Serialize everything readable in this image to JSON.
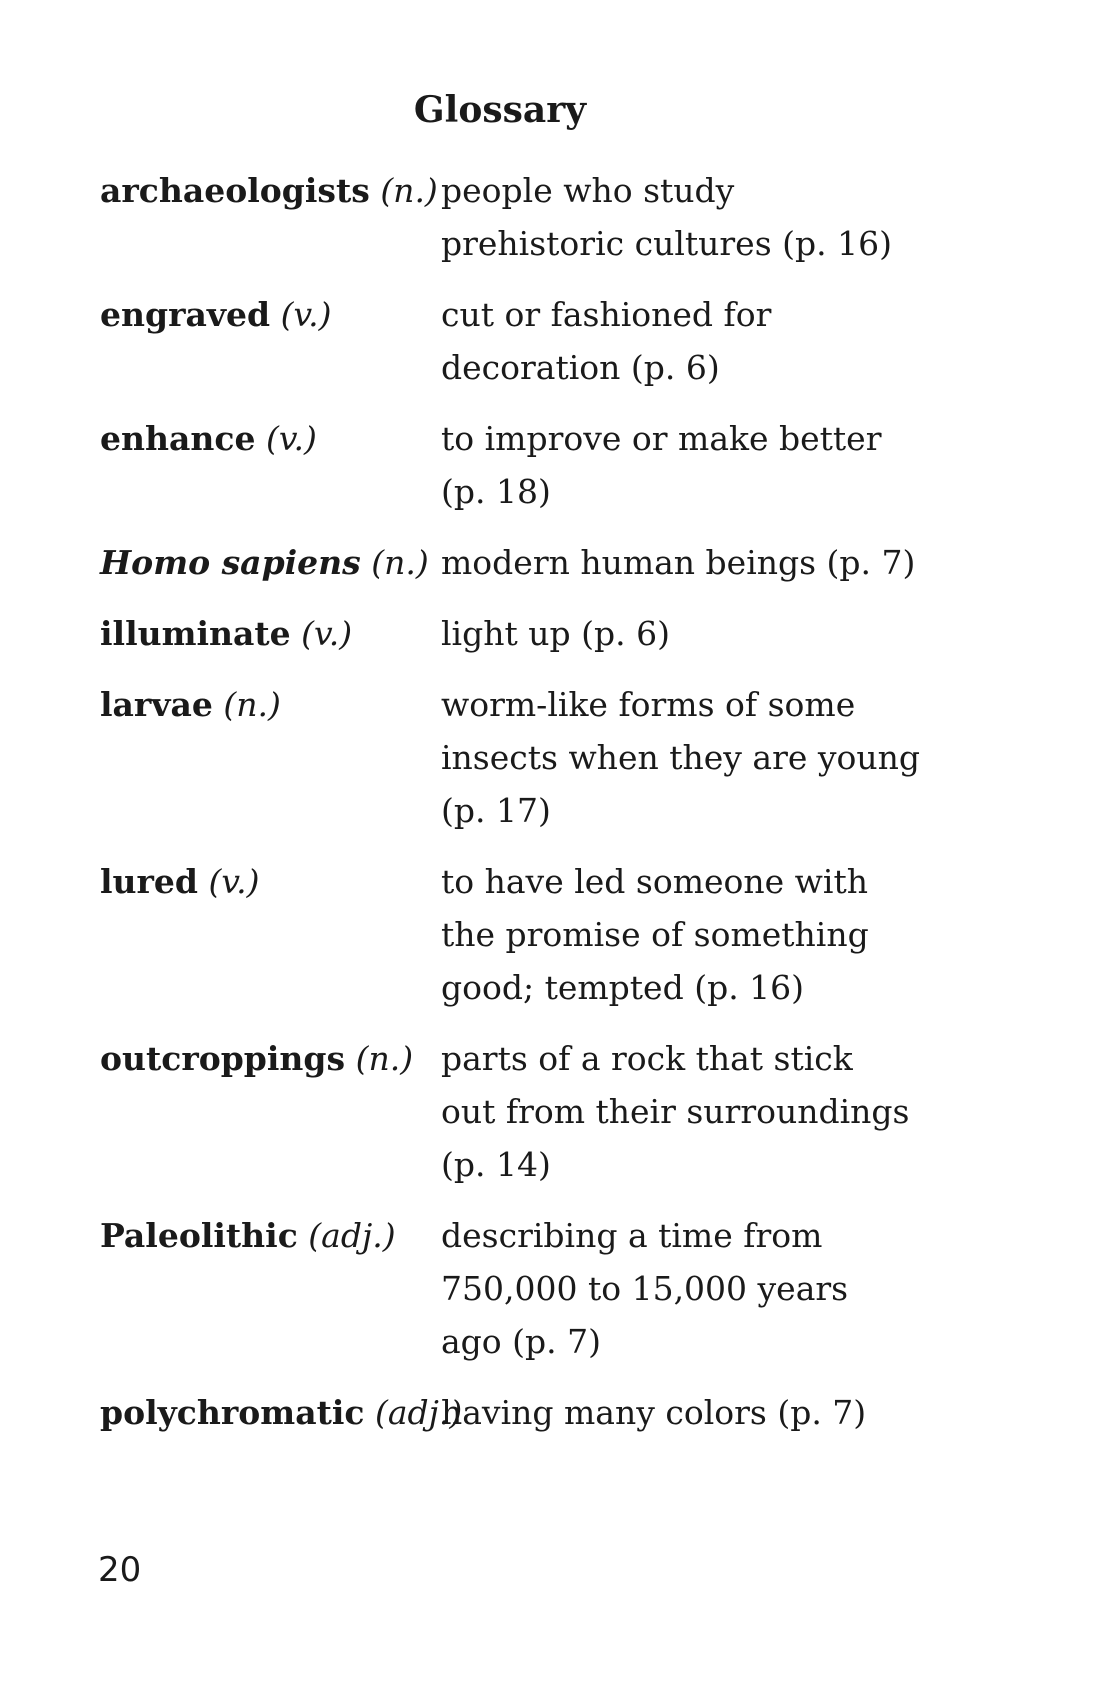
{
  "title": "Glossary",
  "entries": [
    {
      "term": "archaeologists",
      "pos": "(n.)",
      "definition": "people who study\nprehistoric cultures (p. 16)"
    },
    {
      "term": "engraved",
      "pos": "(v.)",
      "definition": "cut or fashioned for\ndecoration (p. 6)"
    },
    {
      "term": "enhance",
      "pos": "(v.)",
      "definition": "to improve or make better\n(p. 18)"
    },
    {
      "term": "Homo sapiens",
      "pos": "(n.)",
      "definition": "modern human beings (p. 7)"
    },
    {
      "term": "illuminate",
      "pos": "(v.)",
      "definition": "light up (p. 6)"
    },
    {
      "term": "larvae",
      "pos": "(n.)",
      "definition": "worm-like forms of some\ninsects when they are young\n(p. 17)"
    },
    {
      "term": "lured",
      "pos": "(v.)",
      "definition": "to have led someone with\nthe promise of something\ngood; tempted (p. 16)"
    },
    {
      "term": "outcroppings",
      "pos": "(n.)",
      "definition": "parts of a rock that stick\nout from their surroundings\n(p. 14)"
    },
    {
      "term": "Paleolithic",
      "pos": "(adj.)",
      "definition": "describing a time from\n750,000 to 15,000 years\nago (p. 7)"
    },
    {
      "term": "polychromatic",
      "pos": "(adj.)",
      "definition": "having many colors (p. 7)"
    }
  ],
  "page_number": "20"
}
